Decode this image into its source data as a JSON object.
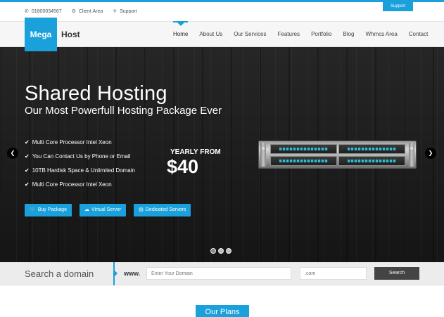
{
  "topbar": {
    "phone": "01800034567",
    "client_area": "Client Area",
    "support": "Support",
    "support_tab": "Support"
  },
  "logo": {
    "part1": "Mega",
    "part2": "Host"
  },
  "nav": {
    "items": [
      {
        "label": "Home",
        "active": true
      },
      {
        "label": "About Us"
      },
      {
        "label": "Our Services"
      },
      {
        "label": "Features"
      },
      {
        "label": "Portfolio"
      },
      {
        "label": "Blog"
      },
      {
        "label": "Whmcs Area"
      },
      {
        "label": "Contact"
      }
    ]
  },
  "hero": {
    "title": "Shared Hosting",
    "subtitle": "Our Most Powerfull Hosting Package Ever",
    "features": [
      "Multi Core Processor Intel Xeon",
      "You Can Contact Us by Phone or Email",
      "10TB Hardisk Space & Unlimited Domain",
      "Multi Core Processor Intel Xeon"
    ],
    "price_label": "YEARLY FROM",
    "price": "$40",
    "buttons": {
      "buy": "Buy Package",
      "virtual": "Virtual Server",
      "dedicated": "Dedicated Servers"
    },
    "slides_total": 3,
    "slide_active": 1
  },
  "domain": {
    "title": "Search a domain",
    "prefix": "www.",
    "name_placeholder": "Enter Your Domain",
    "tld_placeholder": ".com",
    "search_label": "Search"
  },
  "plans": {
    "title": "Our Plans"
  },
  "colors": {
    "accent": "#1aa0db",
    "dark": "#444444"
  }
}
